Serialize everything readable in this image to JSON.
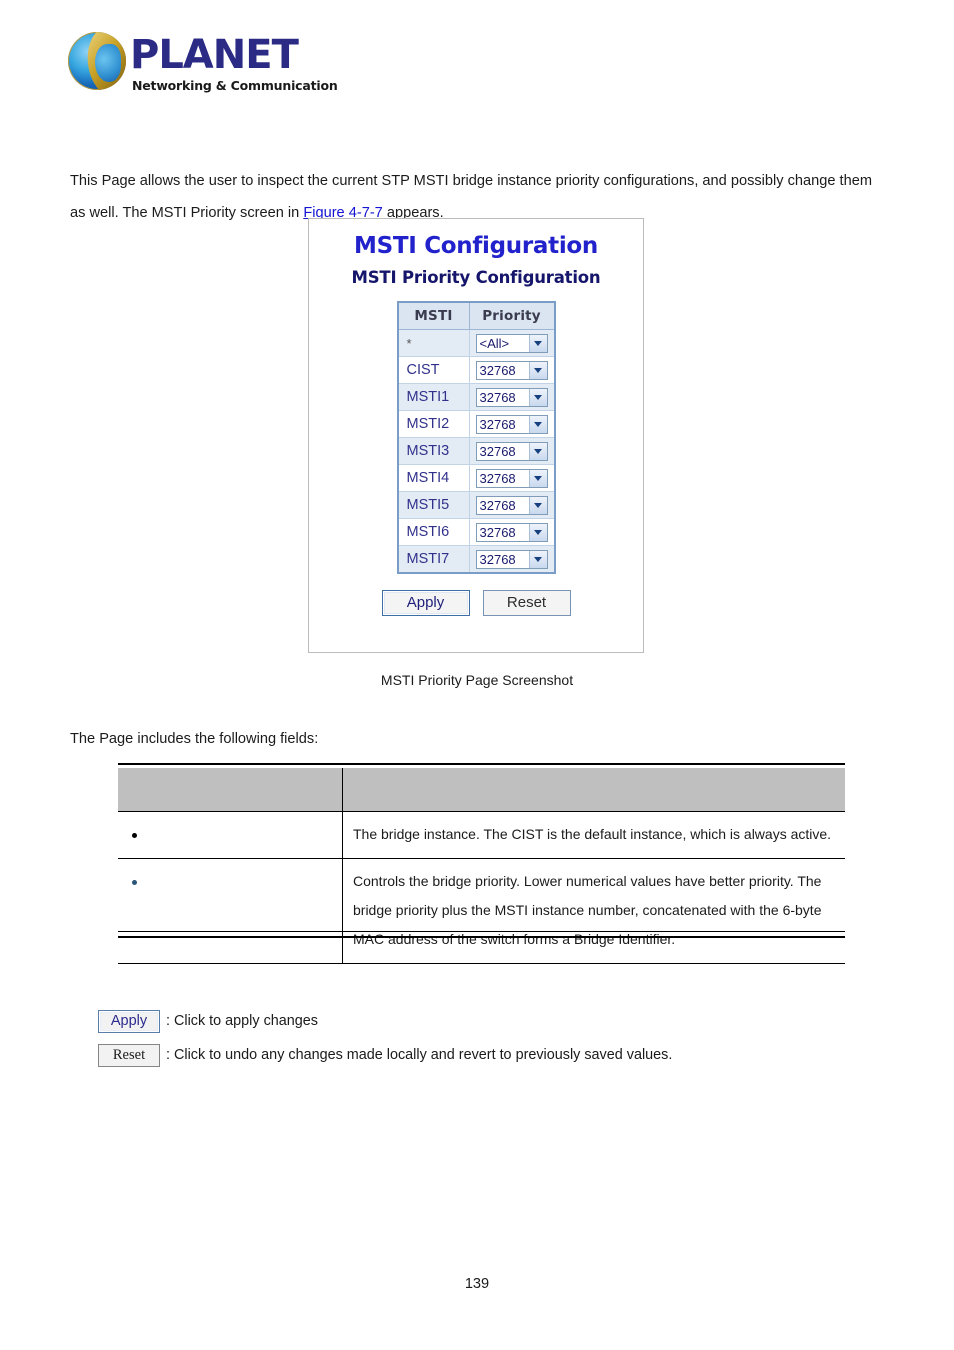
{
  "brand": {
    "name": "PLANET",
    "tagline": "Networking & Communication",
    "logo_icon": "globe-icon",
    "wordmark_color": "#2b2b86"
  },
  "intro": {
    "text_before_link": "This Page allows the user to inspect the current STP MSTI bridge instance priority configurations, and possibly change them as well. The MSTI Priority screen in ",
    "link_text": "Figure 4-7-7",
    "link_color": "#1414d2",
    "text_after_link": " appears."
  },
  "screenshot": {
    "title": "MSTI Configuration",
    "subtitle": "MSTI Priority Configuration",
    "title_color": "#2222cc",
    "subtitle_color": "#15156b",
    "table": {
      "headers": [
        "MSTI",
        "Priority"
      ],
      "rows": [
        {
          "msti": "*",
          "priority": "<All>"
        },
        {
          "msti": "CIST",
          "priority": "32768"
        },
        {
          "msti": "MSTI1",
          "priority": "32768"
        },
        {
          "msti": "MSTI2",
          "priority": "32768"
        },
        {
          "msti": "MSTI3",
          "priority": "32768"
        },
        {
          "msti": "MSTI4",
          "priority": "32768"
        },
        {
          "msti": "MSTI5",
          "priority": "32768"
        },
        {
          "msti": "MSTI6",
          "priority": "32768"
        },
        {
          "msti": "MSTI7",
          "priority": "32768"
        }
      ]
    },
    "buttons": {
      "apply": "Apply",
      "reset": "Reset"
    },
    "caption": "MSTI Priority Page Screenshot"
  },
  "fields_intro": "The Page includes the following fields:",
  "desc_table": {
    "header": {
      "left": "",
      "right": ""
    },
    "rows": [
      {
        "bullet": "black",
        "label": "",
        "description": "The bridge instance. The CIST is the default instance, which is always active."
      },
      {
        "bullet": "blue",
        "label": "",
        "description": "Controls the bridge priority. Lower numerical values have better priority. The bridge priority plus the MSTI instance number, concatenated with the 6-byte MAC address of the switch forms a Bridge Identifier."
      }
    ]
  },
  "legend": [
    {
      "button": "Apply",
      "text": ": Click to apply changes"
    },
    {
      "button": "Reset",
      "text": ": Click to undo any changes made locally and revert to previously saved values."
    }
  ],
  "page_number": "139"
}
